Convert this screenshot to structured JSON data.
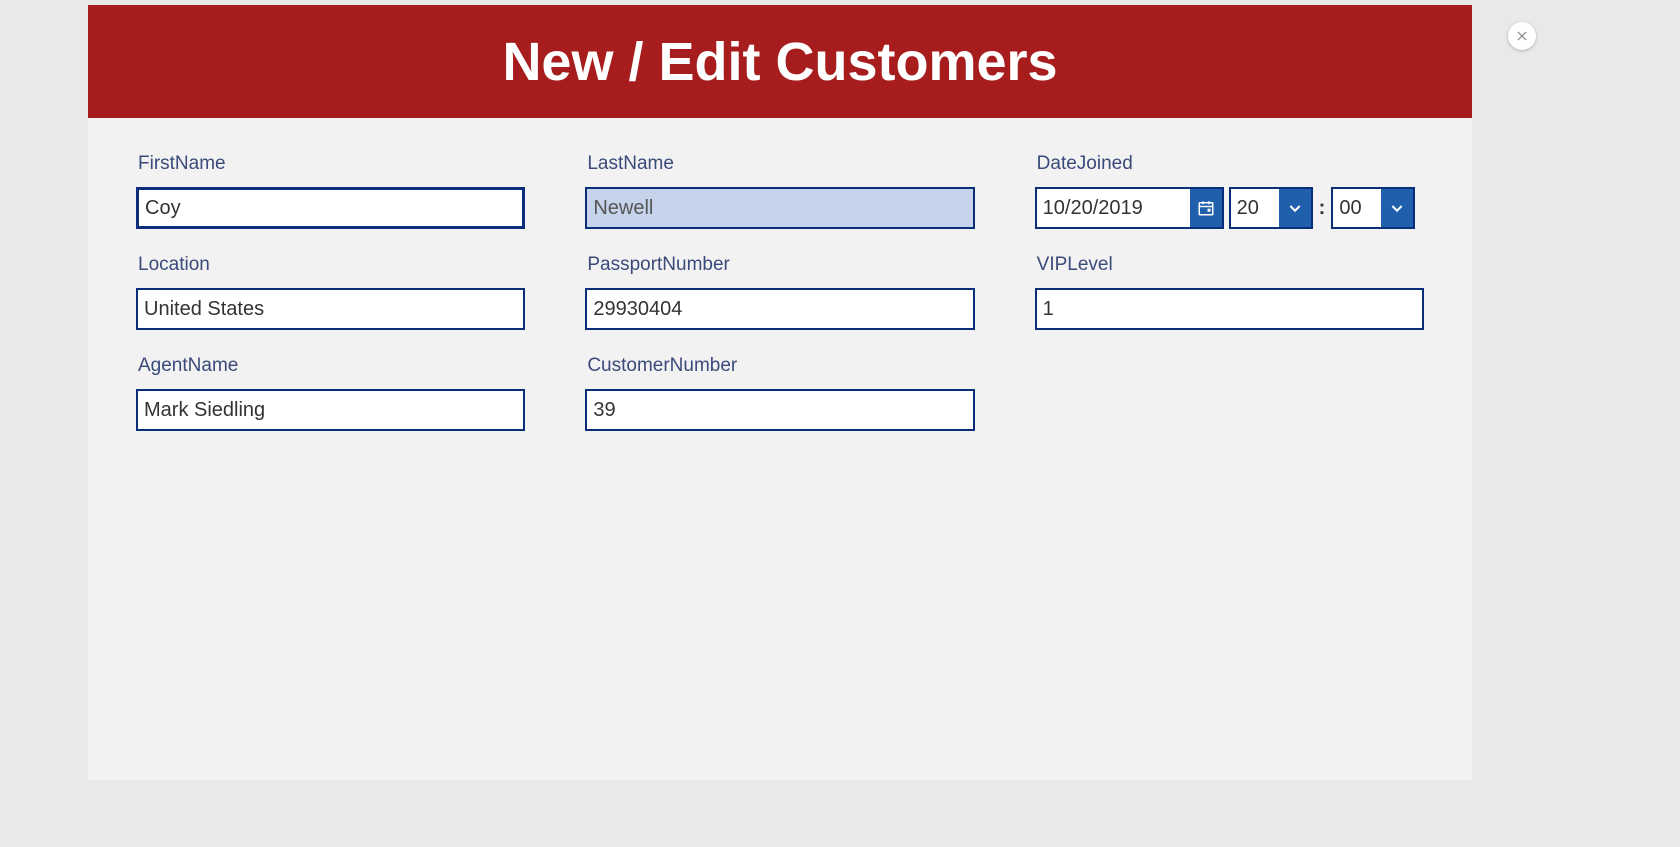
{
  "header": {
    "title": "New / Edit Customers"
  },
  "fields": {
    "firstName": {
      "label": "FirstName",
      "value": "Coy"
    },
    "lastName": {
      "label": "LastName",
      "value": "Newell"
    },
    "dateJoined": {
      "label": "DateJoined",
      "date": "10/20/2019",
      "hour": "20",
      "minute": "00",
      "separator": ":"
    },
    "location": {
      "label": "Location",
      "value": "United States"
    },
    "passportNumber": {
      "label": "PassportNumber",
      "value": "29930404"
    },
    "vipLevel": {
      "label": "VIPLevel",
      "value": "1"
    },
    "agentName": {
      "label": "AgentName",
      "value": "Mark Siedling"
    },
    "customerNumber": {
      "label": "CustomerNumber",
      "value": "39"
    }
  },
  "colors": {
    "headerBg": "#a71d1d",
    "border": "#0a2e7a",
    "accent": "#1f5fac",
    "labelText": "#3a4a7a"
  }
}
